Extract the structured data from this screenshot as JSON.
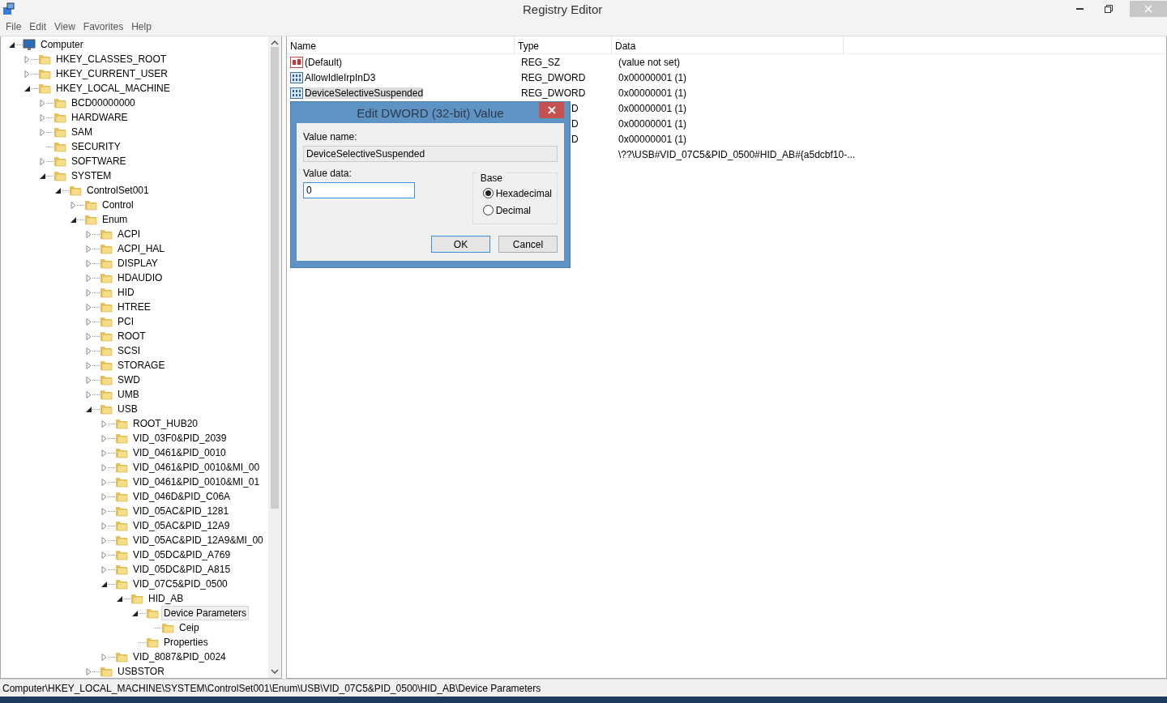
{
  "window": {
    "title": "Registry Editor"
  },
  "menu": [
    "File",
    "Edit",
    "View",
    "Favorites",
    "Help"
  ],
  "tree": [
    {
      "label": "Computer",
      "kind": "computer",
      "expanded": true,
      "selected": false,
      "children": [
        {
          "label": "HKEY_CLASSES_ROOT",
          "kind": "branch",
          "expanded": false,
          "selected": false
        },
        {
          "label": "HKEY_CURRENT_USER",
          "kind": "branch",
          "expanded": false,
          "selected": false
        },
        {
          "label": "HKEY_LOCAL_MACHINE",
          "kind": "branch",
          "expanded": true,
          "selected": false,
          "children": [
            {
              "label": "BCD00000000",
              "kind": "branch",
              "expanded": false,
              "selected": false
            },
            {
              "label": "HARDWARE",
              "kind": "branch",
              "expanded": false,
              "selected": false
            },
            {
              "label": "SAM",
              "kind": "branch",
              "expanded": false,
              "selected": false
            },
            {
              "label": "SECURITY",
              "kind": "leaf",
              "selected": false
            },
            {
              "label": "SOFTWARE",
              "kind": "branch",
              "expanded": false,
              "selected": false
            },
            {
              "label": "SYSTEM",
              "kind": "branch",
              "expanded": true,
              "selected": false,
              "children": [
                {
                  "label": "ControlSet001",
                  "kind": "branch",
                  "expanded": true,
                  "selected": false,
                  "children": [
                    {
                      "label": "Control",
                      "kind": "branch",
                      "expanded": false,
                      "selected": false
                    },
                    {
                      "label": "Enum",
                      "kind": "branch",
                      "expanded": true,
                      "selected": false,
                      "children": [
                        {
                          "label": "ACPI",
                          "kind": "branch",
                          "expanded": false,
                          "selected": false
                        },
                        {
                          "label": "ACPI_HAL",
                          "kind": "branch",
                          "expanded": false,
                          "selected": false
                        },
                        {
                          "label": "DISPLAY",
                          "kind": "branch",
                          "expanded": false,
                          "selected": false
                        },
                        {
                          "label": "HDAUDIO",
                          "kind": "branch",
                          "expanded": false,
                          "selected": false
                        },
                        {
                          "label": "HID",
                          "kind": "branch",
                          "expanded": false,
                          "selected": false
                        },
                        {
                          "label": "HTREE",
                          "kind": "branch",
                          "expanded": false,
                          "selected": false
                        },
                        {
                          "label": "PCI",
                          "kind": "branch",
                          "expanded": false,
                          "selected": false
                        },
                        {
                          "label": "ROOT",
                          "kind": "branch",
                          "expanded": false,
                          "selected": false
                        },
                        {
                          "label": "SCSI",
                          "kind": "branch",
                          "expanded": false,
                          "selected": false
                        },
                        {
                          "label": "STORAGE",
                          "kind": "branch",
                          "expanded": false,
                          "selected": false
                        },
                        {
                          "label": "SWD",
                          "kind": "branch",
                          "expanded": false,
                          "selected": false
                        },
                        {
                          "label": "UMB",
                          "kind": "branch",
                          "expanded": false,
                          "selected": false
                        },
                        {
                          "label": "USB",
                          "kind": "branch",
                          "expanded": true,
                          "selected": false,
                          "children": [
                            {
                              "label": "ROOT_HUB20",
                              "kind": "branch",
                              "expanded": false,
                              "selected": false
                            },
                            {
                              "label": "VID_03F0&PID_2039",
                              "kind": "branch",
                              "expanded": false,
                              "selected": false
                            },
                            {
                              "label": "VID_0461&PID_0010",
                              "kind": "branch",
                              "expanded": false,
                              "selected": false
                            },
                            {
                              "label": "VID_0461&PID_0010&MI_00",
                              "kind": "branch",
                              "expanded": false,
                              "selected": false
                            },
                            {
                              "label": "VID_0461&PID_0010&MI_01",
                              "kind": "branch",
                              "expanded": false,
                              "selected": false
                            },
                            {
                              "label": "VID_046D&PID_C06A",
                              "kind": "branch",
                              "expanded": false,
                              "selected": false
                            },
                            {
                              "label": "VID_05AC&PID_1281",
                              "kind": "branch",
                              "expanded": false,
                              "selected": false
                            },
                            {
                              "label": "VID_05AC&PID_12A9",
                              "kind": "branch",
                              "expanded": false,
                              "selected": false
                            },
                            {
                              "label": "VID_05AC&PID_12A9&MI_00",
                              "kind": "branch",
                              "expanded": false,
                              "selected": false
                            },
                            {
                              "label": "VID_05DC&PID_A769",
                              "kind": "branch",
                              "expanded": false,
                              "selected": false
                            },
                            {
                              "label": "VID_05DC&PID_A815",
                              "kind": "branch",
                              "expanded": false,
                              "selected": false
                            },
                            {
                              "label": "VID_07C5&PID_0500",
                              "kind": "branch",
                              "expanded": true,
                              "selected": false,
                              "children": [
                                {
                                  "label": "HID_AB",
                                  "kind": "branch",
                                  "expanded": true,
                                  "selected": false,
                                  "children": [
                                    {
                                      "label": "Device Parameters",
                                      "kind": "branch",
                                      "expanded": true,
                                      "selected": true,
                                      "children": [
                                        {
                                          "label": "Ceip",
                                          "kind": "leaf",
                                          "selected": false
                                        }
                                      ]
                                    },
                                    {
                                      "label": "Properties",
                                      "kind": "leaf",
                                      "selected": false
                                    }
                                  ]
                                }
                              ]
                            },
                            {
                              "label": "VID_8087&PID_0024",
                              "kind": "branch",
                              "expanded": false,
                              "selected": false
                            }
                          ]
                        },
                        {
                          "label": "USBSTOR",
                          "kind": "branch",
                          "expanded": false,
                          "selected": false
                        }
                      ]
                    }
                  ]
                }
              ]
            }
          ]
        }
      ]
    }
  ],
  "values": {
    "columns": [
      "Name",
      "Type",
      "Data"
    ],
    "rows": [
      {
        "kind": "string",
        "name": "(Default)",
        "type": "REG_SZ",
        "data": "(value not set)",
        "selected": false
      },
      {
        "kind": "binary",
        "name": "AllowIdleIrpInD3",
        "type": "REG_DWORD",
        "data": "0x00000001 (1)",
        "selected": false
      },
      {
        "kind": "binary",
        "name": "DeviceSelectiveSuspended",
        "type": "REG_DWORD",
        "data": "0x00000001 (1)",
        "selected": true
      },
      {
        "kind": "hidden",
        "type": "D",
        "data": "0x00000001 (1)"
      },
      {
        "kind": "hidden",
        "type": "D",
        "data": "0x00000001 (1)"
      },
      {
        "kind": "hidden",
        "type": "D",
        "data": "0x00000001 (1)"
      },
      {
        "kind": "hidden",
        "data": "\\??\\USB#VID_07C5&PID_0500#HID_AB#{a5dcbf10-..."
      }
    ]
  },
  "dialog": {
    "title": "Edit DWORD (32-bit) Value",
    "value_name_label": "Value name:",
    "value_name": "DeviceSelectiveSuspended",
    "value_data_label": "Value data:",
    "value_data": "0",
    "base_label": "Base",
    "base_options": [
      {
        "label": "Hexadecimal",
        "selected": true
      },
      {
        "label": "Decimal",
        "selected": false
      }
    ],
    "buttons": [
      {
        "label": "OK",
        "default": true
      },
      {
        "label": "Cancel",
        "default": false
      }
    ]
  },
  "status_bar": "Computer\\HKEY_LOCAL_MACHINE\\SYSTEM\\ControlSet001\\Enum\\USB\\VID_07C5&PID_0500\\HID_AB\\Device Parameters"
}
